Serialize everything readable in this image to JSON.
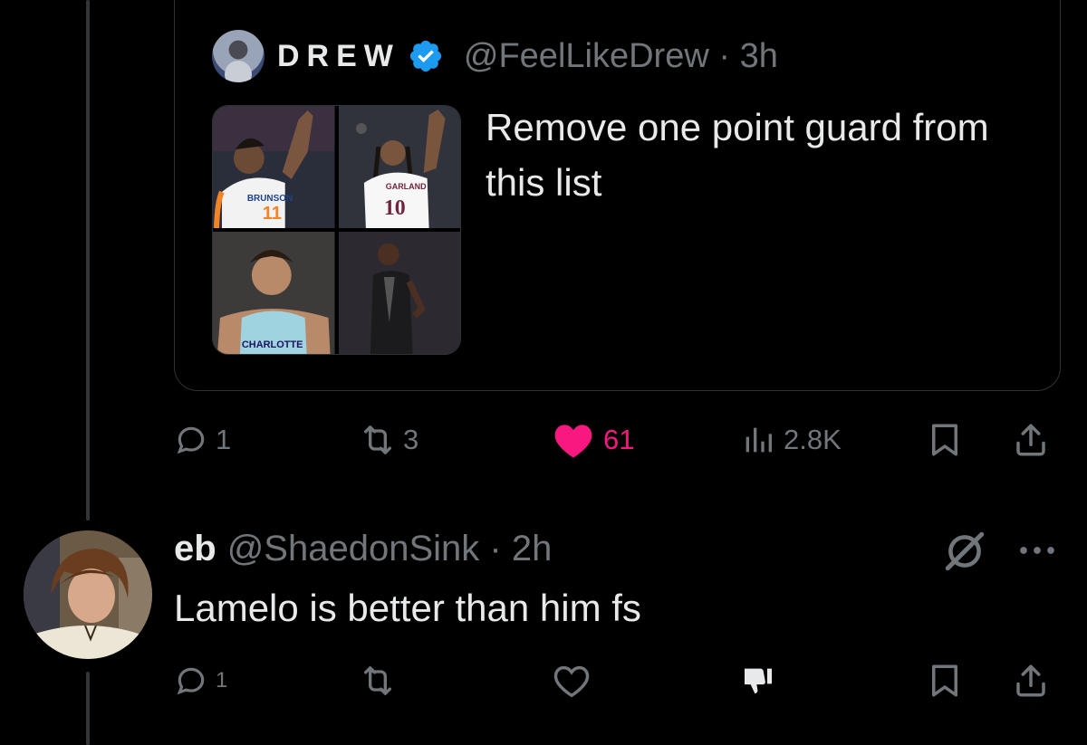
{
  "quoted_tweet": {
    "display_name": "DREW",
    "handle": "@FeelLikeDrew",
    "separator": "·",
    "time": "3h",
    "verified_icon": "verified-badge-icon",
    "text": "Remove one point guard from this list",
    "media": [
      {
        "jersey": "BRUNSON",
        "number": "11",
        "kind": "knicks"
      },
      {
        "jersey": "GARLAND",
        "number": "10",
        "kind": "cavs"
      },
      {
        "jersey": "CHARLOTTE",
        "number": "",
        "kind": "hornets"
      },
      {
        "jersey": "",
        "number": "",
        "kind": "kings"
      }
    ]
  },
  "main_actions": {
    "reply_count": "1",
    "retweet_count": "3",
    "like_count": "61",
    "views_count": "2.8K",
    "like_color": "#f91880"
  },
  "reply": {
    "name": "eb",
    "handle": "@ShaedonSink",
    "separator": "·",
    "time": "2h",
    "text": "Lamelo is better than him fs",
    "reply_count": "1"
  },
  "colors": {
    "background": "#000000",
    "text": "#e7e9ea",
    "muted": "#71767b",
    "verified": "#1d9bf0"
  }
}
